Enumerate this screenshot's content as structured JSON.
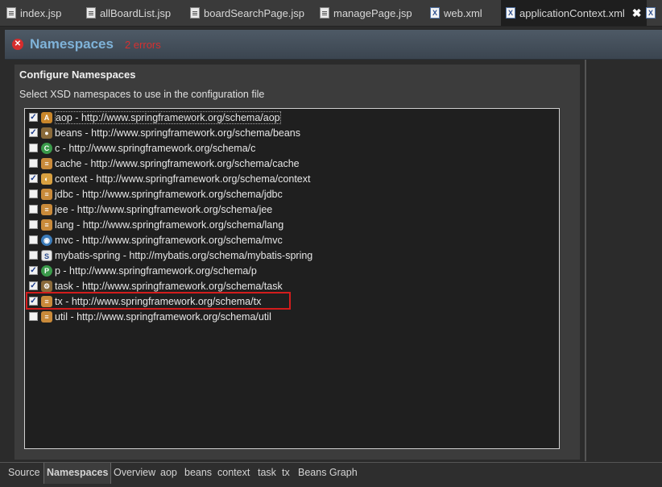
{
  "tabs": [
    {
      "label": "index.jsp",
      "icon": "jsp-file-icon"
    },
    {
      "label": "allBoardList.jsp",
      "icon": "jsp-file-icon"
    },
    {
      "label": "boardSearchPage.jsp",
      "icon": "jsp-file-icon"
    },
    {
      "label": "managePage.jsp",
      "icon": "jsp-file-icon"
    },
    {
      "label": "web.xml",
      "icon": "xml-file-icon"
    },
    {
      "label": "applicationContext.xml",
      "icon": "xml-file-icon",
      "active": true
    }
  ],
  "close_glyph": "✖",
  "header": {
    "title": "Namespaces",
    "error_text": "2 errors",
    "error_icon_glyph": "✕"
  },
  "section": {
    "title": "Configure Namespaces",
    "description": "Select XSD namespaces to use in the configuration file"
  },
  "namespaces": [
    {
      "label": "aop - http://www.springframework.org/schema/aop",
      "checked": true,
      "icon": "aop-icon"
    },
    {
      "label": "beans - http://www.springframework.org/schema/beans",
      "checked": true,
      "icon": "beans-icon"
    },
    {
      "label": "c - http://www.springframework.org/schema/c",
      "checked": false,
      "icon": "c-icon"
    },
    {
      "label": "cache - http://www.springframework.org/schema/cache",
      "checked": false,
      "icon": "cache-icon"
    },
    {
      "label": "context - http://www.springframework.org/schema/context",
      "checked": true,
      "icon": "context-icon"
    },
    {
      "label": "jdbc - http://www.springframework.org/schema/jdbc",
      "checked": false,
      "icon": "jdbc-icon"
    },
    {
      "label": "jee - http://www.springframework.org/schema/jee",
      "checked": false,
      "icon": "jee-icon"
    },
    {
      "label": "lang - http://www.springframework.org/schema/lang",
      "checked": false,
      "icon": "lang-icon"
    },
    {
      "label": "mvc - http://www.springframework.org/schema/mvc",
      "checked": false,
      "icon": "mvc-icon"
    },
    {
      "label": "mybatis-spring - http://mybatis.org/schema/mybatis-spring",
      "checked": false,
      "icon": "mybatis-icon"
    },
    {
      "label": "p - http://www.springframework.org/schema/p",
      "checked": true,
      "icon": "p-icon"
    },
    {
      "label": "task - http://www.springframework.org/schema/task",
      "checked": true,
      "icon": "task-icon"
    },
    {
      "label": "tx - http://www.springframework.org/schema/tx",
      "checked": true,
      "icon": "tx-icon",
      "highlighted": true
    },
    {
      "label": "util - http://www.springframework.org/schema/util",
      "checked": false,
      "icon": "util-icon"
    }
  ],
  "bottom_tabs": [
    {
      "label": "Source"
    },
    {
      "label": "Namespaces",
      "active": true
    },
    {
      "label": "Overview"
    },
    {
      "label": "aop"
    },
    {
      "label": "beans"
    },
    {
      "label": "context"
    },
    {
      "label": "task"
    },
    {
      "label": "tx"
    },
    {
      "label": "Beans Graph"
    }
  ],
  "colors": {
    "header_title": "#7fb3d9",
    "error": "#d63030",
    "highlight_frame": "#d31c1c"
  }
}
